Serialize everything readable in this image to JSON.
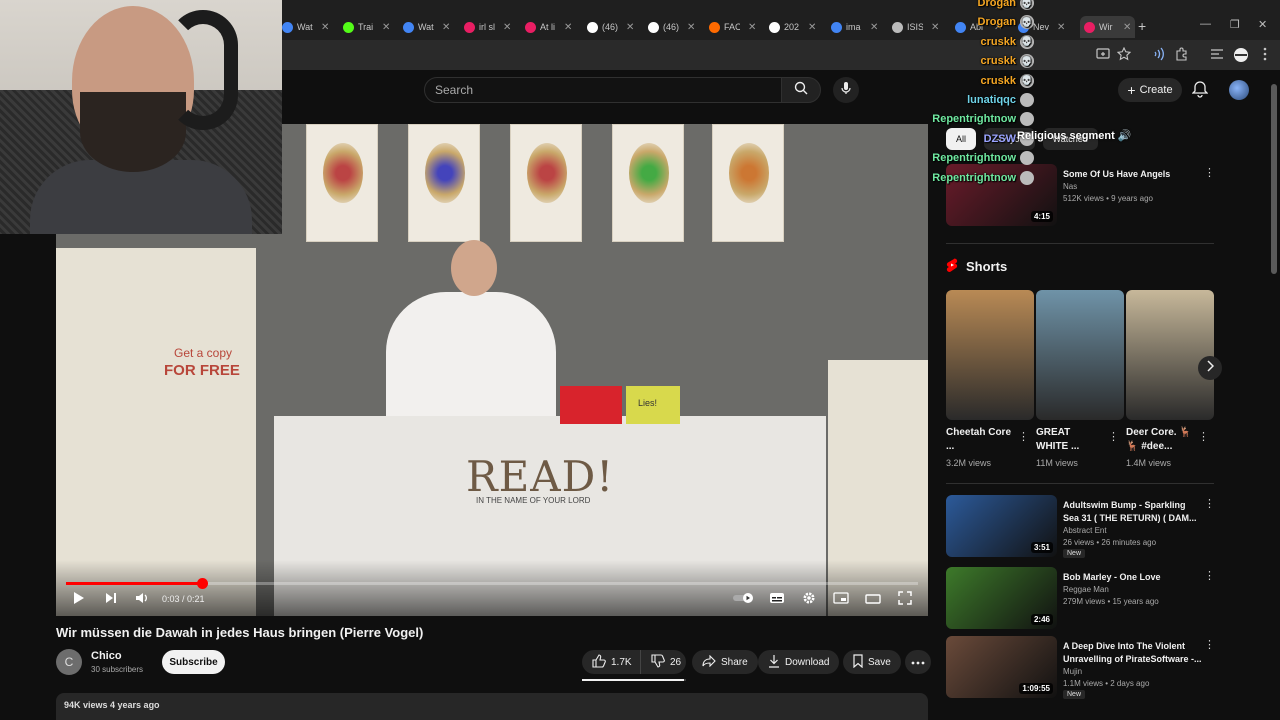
{
  "browser": {
    "tabs": [
      {
        "label": "Wat",
        "color": "#4285f4"
      },
      {
        "label": "Trai",
        "color": "#53fc18"
      },
      {
        "label": "Wat",
        "color": "#4285f4"
      },
      {
        "label": "irl sl",
        "color": "#e91e63"
      },
      {
        "label": "At li",
        "color": "#e91e63"
      },
      {
        "label": "(46)",
        "color": "#ffffff"
      },
      {
        "label": "(46)",
        "color": "#ffffff"
      },
      {
        "label": "FAC",
        "color": "#ff6a00"
      },
      {
        "label": "202",
        "color": "#ffffff"
      },
      {
        "label": "ima",
        "color": "#4285f4"
      },
      {
        "label": "ISIS",
        "color": "#bbbbbb"
      },
      {
        "label": "Abi",
        "color": "#4285f4"
      },
      {
        "label": "Nev",
        "color": "#4285f4"
      },
      {
        "label": "Wir",
        "color": "#e91e63"
      }
    ],
    "new_tab": "+",
    "min": "—",
    "max": "❐",
    "close": "✕"
  },
  "header": {
    "search_placeholder": "Search",
    "create_label": "Create"
  },
  "player": {
    "time": "0:03 / 0:21",
    "progress": 0.16,
    "scene": {
      "getcopy": "Get a copy",
      "forfree": "FOR FREE",
      "read": "READ!",
      "read_sub": "IN THE NAME OF YOUR LORD",
      "yellow_box": "Lies!"
    }
  },
  "video": {
    "title": "Wir müssen die Dawah in jedes Haus bringen (Pierre Vogel)",
    "channel_initial": "C",
    "channel_name": "Chico",
    "subscribers": "30 subscribers",
    "subscribe_label": "Subscribe",
    "likes": "1.7K",
    "dislikes": "26",
    "share_label": "Share",
    "download_label": "Download",
    "save_label": "Save",
    "like_ratio": 0.98,
    "desc_meta": "94K views  4 years ago"
  },
  "chips": [
    "All",
    "For you",
    "Watched"
  ],
  "recommendations_top": [
    {
      "title": "Some Of Us Have Angels",
      "channel": "Nas",
      "stats": "512K views • 9 years ago",
      "duration": "4:15",
      "thumb": "#6a1b2a"
    }
  ],
  "shorts": {
    "heading": "Shorts",
    "items": [
      {
        "title": "Cheetah Core ...",
        "views": "3.2M views",
        "thumb": "#b98a55"
      },
      {
        "title": "GREAT WHITE ...",
        "views": "11M views",
        "thumb": "#6f93a8"
      },
      {
        "title": "Deer Core. 🦌🦌 #dee...",
        "views": "1.4M views",
        "thumb": "#c7b89a"
      }
    ]
  },
  "recommendations": [
    {
      "title": "Adultswim Bump - Sparkling Sea 31 ( THE RETURN) ( DAM...",
      "channel": "Abstract Ent",
      "stats": "26 views • 26 minutes ago",
      "duration": "3:51",
      "new": "New",
      "thumb": "#2c5a9a"
    },
    {
      "title": "Bob Marley - One Love",
      "channel": "Reggae Man",
      "stats": "279M views • 15 years ago",
      "duration": "2:46",
      "new": "",
      "thumb": "#3d7a2a"
    },
    {
      "title": "A Deep Dive Into The Violent Unravelling of PirateSoftware -...",
      "channel": "Mujin",
      "stats": "1.1M views • 2 days ago",
      "duration": "1:09:55",
      "new": "New",
      "thumb": "#6a4a3a"
    }
  ],
  "chat": [
    {
      "user": "Drogan",
      "color": "#f5a623",
      "emote": "💀"
    },
    {
      "user": "Drogan",
      "color": "#f5a623",
      "emote": "💀"
    },
    {
      "user": "cruskk",
      "color": "#f5a623",
      "emote": "💀"
    },
    {
      "user": "cruskk",
      "color": "#f5a623",
      "emote": "💀"
    },
    {
      "user": "cruskk",
      "color": "#f5a623",
      "emote": "💀"
    },
    {
      "user": "lunatiqqc",
      "color": "#6fd3e8",
      "emote": ""
    },
    {
      "user": "Repentrightnow",
      "color": "#6fe8a0",
      "emote": ""
    },
    {
      "user": "DZSW",
      "color": "#9aa3ff",
      "emote": ""
    },
    {
      "user": "Repentrightnow",
      "color": "#6fe8a0",
      "emote": ""
    },
    {
      "user": "Repentrightnow",
      "color": "#6fe8a0",
      "emote": ""
    }
  ],
  "chat_message": "Religious segment 🔊",
  "colors": {
    "accent": "#ff0000",
    "bg": "#0f0f0f"
  }
}
